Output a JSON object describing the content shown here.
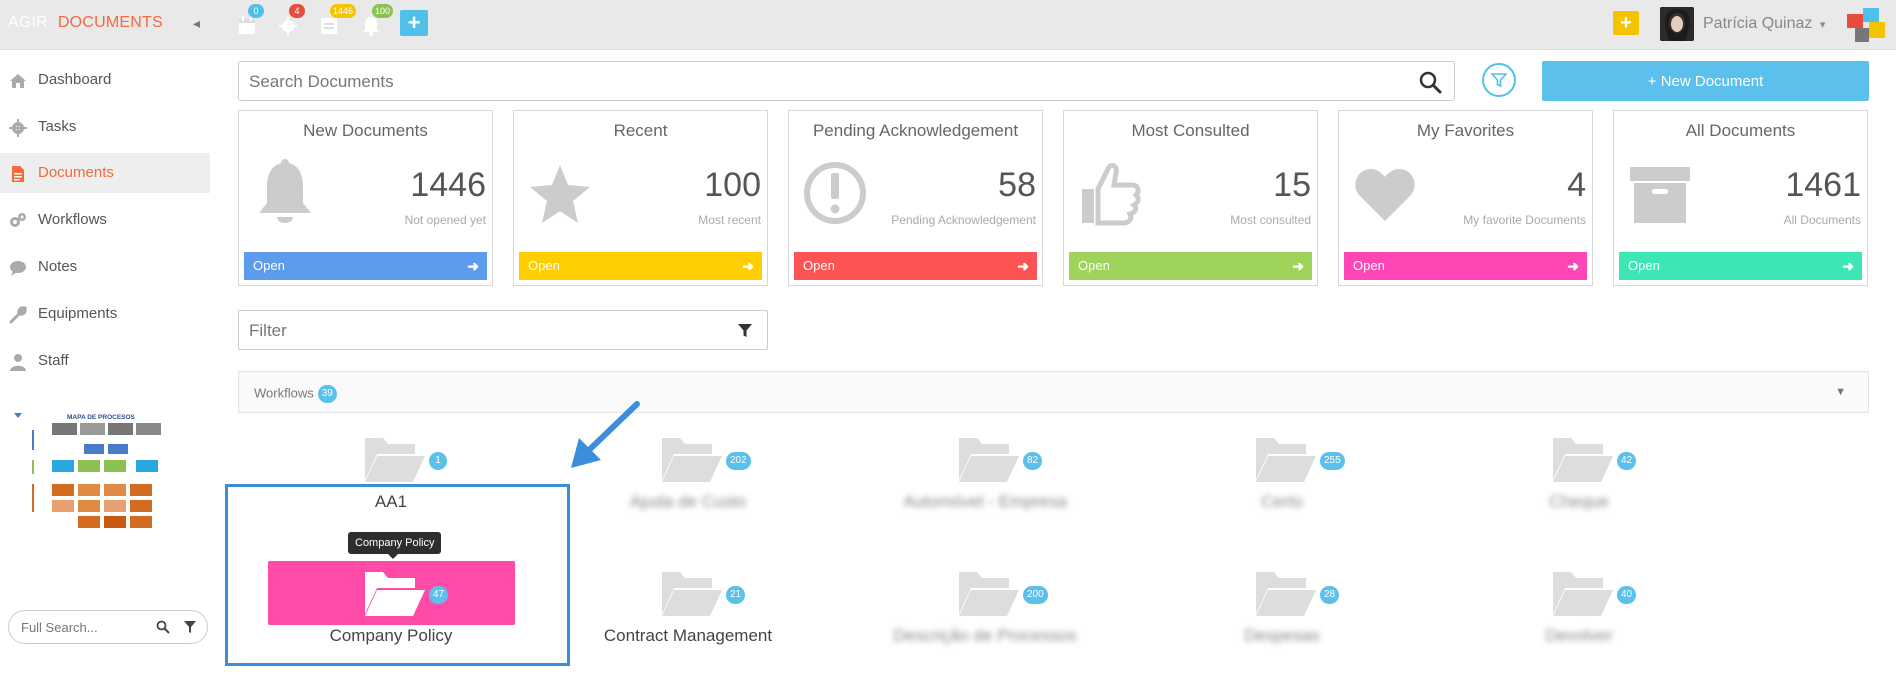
{
  "app": {
    "brand_left": "AGIR",
    "brand_right": "DOCUMENTS",
    "collapse_icon": "chevron-left-icon"
  },
  "topbar": {
    "icons": [
      {
        "name": "calendar-icon",
        "badge": "0",
        "badge_color": "#4fc1e9"
      },
      {
        "name": "gear-icon",
        "badge": "4",
        "badge_color": "#e84c3d"
      },
      {
        "name": "document-icon",
        "badge": "1446",
        "badge_color": "#f5c400"
      },
      {
        "name": "bell-icon",
        "badge": "100",
        "badge_color": "#8cc152"
      }
    ],
    "plus_label": "+",
    "quick_add_label": "+",
    "user_name": "Patrícia Quinaz"
  },
  "sidebar": {
    "items": [
      {
        "label": "Dashboard",
        "icon": "home-icon"
      },
      {
        "label": "Tasks",
        "icon": "gear-icon"
      },
      {
        "label": "Documents",
        "icon": "document-icon",
        "active": true
      },
      {
        "label": "Workflows",
        "icon": "workflow-icon"
      },
      {
        "label": "Notes",
        "icon": "comment-icon"
      },
      {
        "label": "Equipments",
        "icon": "wrench-icon"
      },
      {
        "label": "Staff",
        "icon": "user-icon"
      }
    ],
    "process_map_title": "MAPA DE PROCESOS",
    "full_search_placeholder": "Full Search..."
  },
  "search": {
    "placeholder": "Search Documents"
  },
  "new_document_label": "+ New Document",
  "cards": [
    {
      "title": "New Documents",
      "value": "1446",
      "subtitle": "Not opened yet",
      "open_label": "Open",
      "color": "#5d9cec",
      "icon": "bell-icon"
    },
    {
      "title": "Recent",
      "value": "100",
      "subtitle": "Most recent",
      "open_label": "Open",
      "color": "#ffce00",
      "icon": "star-icon"
    },
    {
      "title": "Pending Acknowledgement",
      "value": "58",
      "subtitle": "Pending Acknowledgement",
      "open_label": "Open",
      "color": "#fc5454",
      "icon": "exclamation-circle-icon"
    },
    {
      "title": "Most Consulted",
      "value": "15",
      "subtitle": "Most consulted",
      "open_label": "Open",
      "color": "#9fd35a",
      "icon": "thumbs-up-icon"
    },
    {
      "title": "My Favorites",
      "value": "4",
      "subtitle": "My favorite Documents",
      "open_label": "Open",
      "color": "#ff46b5",
      "icon": "heart-icon"
    },
    {
      "title": "All Documents",
      "value": "1461",
      "subtitle": "All Documents",
      "open_label": "Open",
      "color": "#3de6b5",
      "icon": "archive-icon"
    }
  ],
  "filter": {
    "placeholder": "Filter"
  },
  "workflows": {
    "label": "Workflows",
    "count": "39"
  },
  "folders": [
    {
      "name": "AA1",
      "count": "1",
      "blurred": false
    },
    {
      "name": "Ajuda de Custo",
      "count": "202",
      "blurred": true
    },
    {
      "name": "Automóvel - Empresa",
      "count": "82",
      "blurred": true
    },
    {
      "name": "Certo",
      "count": "255",
      "blurred": true
    },
    {
      "name": "Cheque",
      "count": "42",
      "blurred": true
    },
    {
      "name": "Company Policy",
      "count": "47",
      "blurred": false,
      "highlighted": true
    },
    {
      "name": "Contract Management",
      "count": "21",
      "blurred": false
    },
    {
      "name": "Descrição de Processos",
      "count": "200",
      "blurred": true
    },
    {
      "name": "Despesas",
      "count": "28",
      "blurred": true
    },
    {
      "name": "Devolver",
      "count": "40",
      "blurred": true
    }
  ],
  "tooltip": "Company Policy"
}
